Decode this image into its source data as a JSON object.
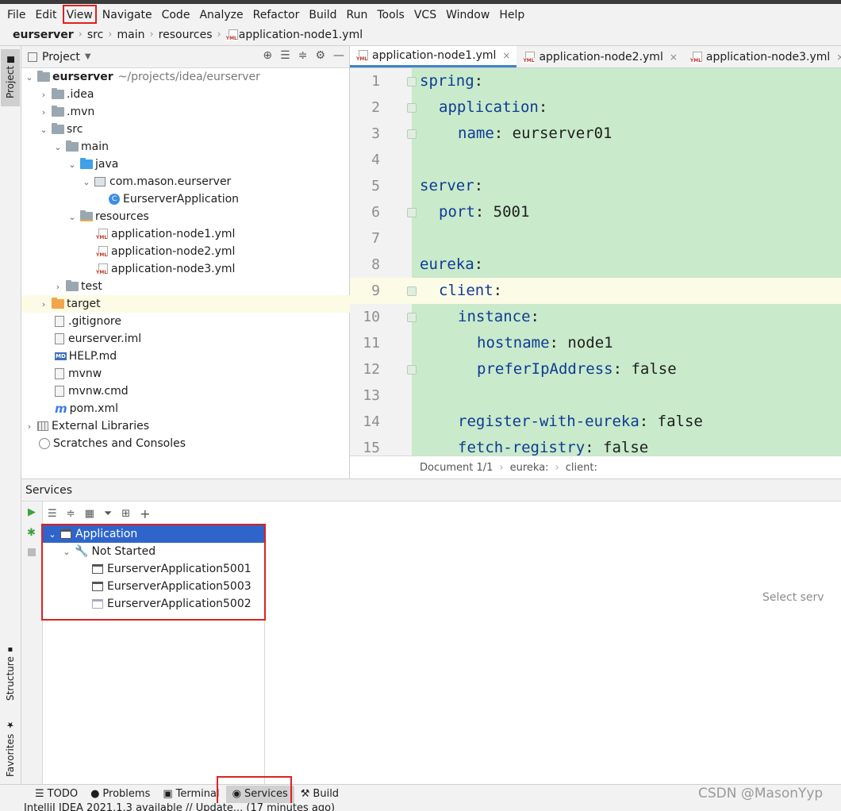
{
  "menu": [
    "File",
    "Edit",
    "View",
    "Navigate",
    "Code",
    "Analyze",
    "Refactor",
    "Build",
    "Run",
    "Tools",
    "VCS",
    "Window",
    "Help"
  ],
  "breadcrumb": [
    "eurserver",
    "src",
    "main",
    "resources",
    "application-node1.yml"
  ],
  "left_stripe": {
    "project": "Project",
    "structure": "Structure",
    "favorites": "Favorites"
  },
  "project": {
    "title": "Project",
    "root_name": "eurserver",
    "root_path": "~/projects/idea/eurserver",
    "items": [
      ".idea",
      ".mvn",
      "src",
      "main",
      "java",
      "com.mason.eurserver",
      "EurserverApplication",
      "resources",
      "application-node1.yml",
      "application-node2.yml",
      "application-node3.yml",
      "test",
      "target",
      ".gitignore",
      "eurserver.iml",
      "HELP.md",
      "mvnw",
      "mvnw.cmd",
      "pom.xml",
      "External Libraries",
      "Scratches and Consoles"
    ]
  },
  "editor": {
    "tabs": [
      "application-node1.yml",
      "application-node2.yml",
      "application-node3.yml"
    ],
    "line_numbers": [
      "1",
      "2",
      "3",
      "4",
      "5",
      "6",
      "7",
      "8",
      "9",
      "10",
      "11",
      "12",
      "13",
      "14",
      "15"
    ],
    "lines": [
      {
        "key": "spring",
        "sep": ":",
        "val": ""
      },
      {
        "key": "application",
        "sep": ":",
        "val": ""
      },
      {
        "key": "name",
        "sep": ":",
        "val": " eurserver01"
      },
      {
        "key": "",
        "sep": "",
        "val": ""
      },
      {
        "key": "server",
        "sep": ":",
        "val": ""
      },
      {
        "key": "port",
        "sep": ":",
        "val": " 5001"
      },
      {
        "key": "",
        "sep": "",
        "val": ""
      },
      {
        "key": "eureka",
        "sep": ":",
        "val": ""
      },
      {
        "key": "client",
        "sep": ":",
        "val": ""
      },
      {
        "key": "instance",
        "sep": ":",
        "val": ""
      },
      {
        "key": "hostname",
        "sep": ":",
        "val": " node1"
      },
      {
        "key": "preferIpAddress",
        "sep": ":",
        "val": " false"
      },
      {
        "key": "",
        "sep": "",
        "val": ""
      },
      {
        "key": "register-with-eureka",
        "sep": ":",
        "val": " false"
      },
      {
        "key": "fetch-registry",
        "sep": ":",
        "val": " false"
      }
    ],
    "status": [
      "Document 1/1",
      "eureka:",
      "client:"
    ]
  },
  "services": {
    "title": "Services",
    "tree": [
      "Application",
      "Not Started",
      "EurserverApplication5001",
      "EurserverApplication5003",
      "EurserverApplication5002"
    ],
    "hint": "Select serv"
  },
  "bottom_tabs": [
    "TODO",
    "Problems",
    "Terminal",
    "Services",
    "Build"
  ],
  "status_text": "IntelliJ IDEA 2021.1.3 available // Update... (17 minutes ago)",
  "watermark": "CSDN @MasonYyp",
  "colors": {
    "code_bg": "#c9eacb",
    "selection": "#2f65ca",
    "highlight_box": "#e02020",
    "yaml_key": "#0f3b94"
  }
}
